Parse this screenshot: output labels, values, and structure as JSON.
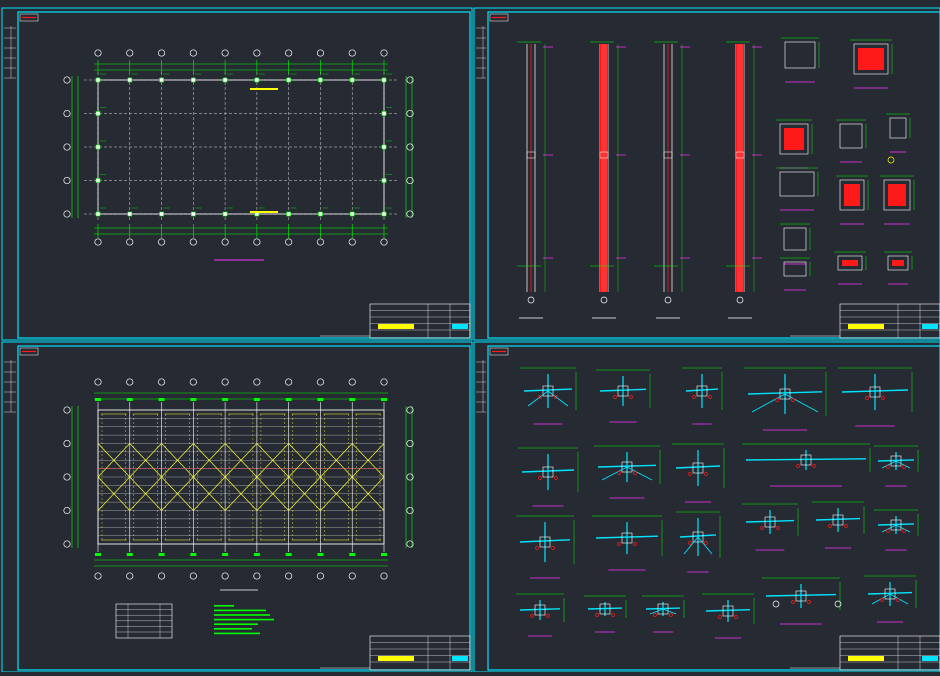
{
  "colors": {
    "background": "#262a33",
    "sheet_frame": "#00e5ff",
    "grid_line": "#ffffff",
    "dim_line": "#00ff00",
    "steel_red": "#ff1a1a",
    "title_text": "#ffff00",
    "magenta_label": "#ff33ff",
    "bracing_yellow": "#ffff33"
  },
  "sheets": [
    {
      "name": "sheet-foundation-plan",
      "content": "column-grid-plan"
    },
    {
      "name": "sheet-column-details",
      "content": "column-elevations-and-sections"
    },
    {
      "name": "sheet-roof-bracing-plan",
      "content": "roof-bracing-plan"
    },
    {
      "name": "sheet-connection-details",
      "content": "connection-node-details"
    }
  ],
  "grid": {
    "columns": 10,
    "rows_plan": 5,
    "rows_roof": 5
  },
  "icons": {
    "column_marker": "column-square-icon",
    "axis_bubble": "axis-bubble-icon",
    "node_detail": "node-detail-icon"
  }
}
